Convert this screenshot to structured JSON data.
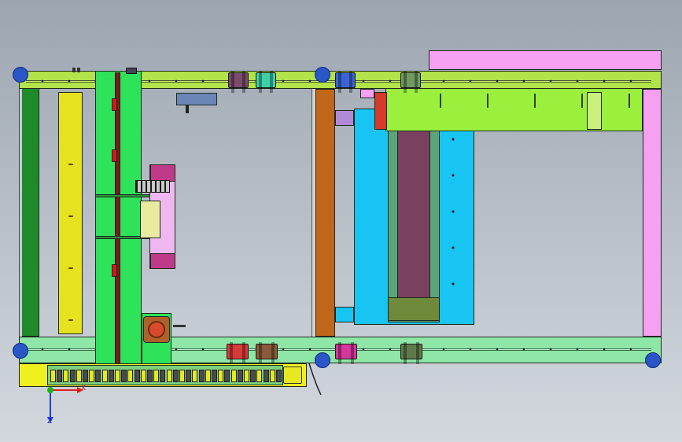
{
  "window": {
    "title": ""
  },
  "triad": {
    "x_label": "X",
    "y_label": "Y",
    "z_label": "Z"
  },
  "colors": {
    "background_top": "#9ca5b0",
    "background_bottom": "#d3d8de",
    "top_rail": "#b3e34a",
    "bottom_rail": "#8ee6a7",
    "left_beam": "#1f8a2a",
    "yellow_bar": "#e6e21f",
    "carriage_plate": "#2ee35a",
    "orange_post": "#c0661a",
    "cyan_table": "#18c4f2",
    "lime_frame": "#9af03c",
    "pink_frame": "#f5a0f0",
    "plum_belt": "#7a4060",
    "chain_tray": "#f0f020"
  },
  "slider_blocks": [
    {
      "name": "slider-block-top-1",
      "color": "#7a4a6a"
    },
    {
      "name": "slider-block-top-2",
      "color": "#3fd0a8"
    },
    {
      "name": "slider-block-top-3",
      "color": "#3a63d6"
    },
    {
      "name": "slider-block-top-4",
      "color": "#6f9a62"
    },
    {
      "name": "slider-block-bottom-1",
      "color": "#d63a3a"
    },
    {
      "name": "slider-block-bottom-2",
      "color": "#8a5a3a"
    },
    {
      "name": "slider-block-bottom-3",
      "color": "#d6359c"
    },
    {
      "name": "slider-block-bottom-4",
      "color": "#5f7a4a"
    }
  ],
  "icons": [
    "coordinate-triad-icon",
    "motor-icon",
    "cable-icon"
  ]
}
